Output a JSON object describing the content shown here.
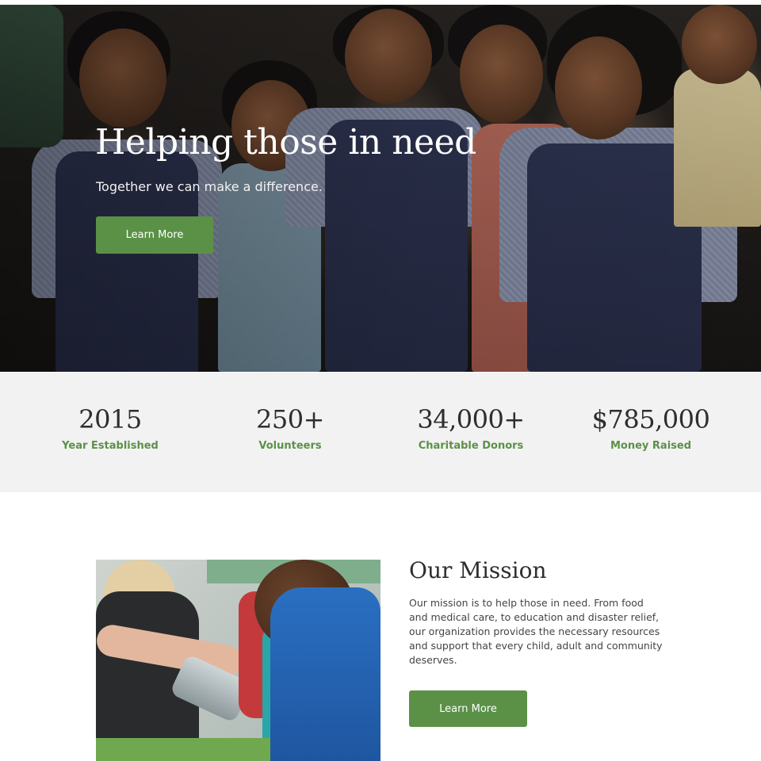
{
  "hero": {
    "title": "Helping those in need",
    "subtitle": "Together we can make a difference.",
    "button_label": "Learn More"
  },
  "stats": [
    {
      "value": "2015",
      "label": "Year Established"
    },
    {
      "value": "250+",
      "label": "Volunteers"
    },
    {
      "value": "34,000+",
      "label": "Charitable Donors"
    },
    {
      "value": "$785,000",
      "label": "Money Raised"
    }
  ],
  "mission": {
    "title": "Our Mission",
    "text": "Our mission is to help those in need. From food and medical care, to education and disaster relief, our organization provides the necessary resources and support that every child, adult and community deserves.",
    "button_label": "Learn More"
  },
  "colors": {
    "accent": "#5a9147",
    "stats_background": "#f2f2f2",
    "heading": "#2e2e2e"
  }
}
